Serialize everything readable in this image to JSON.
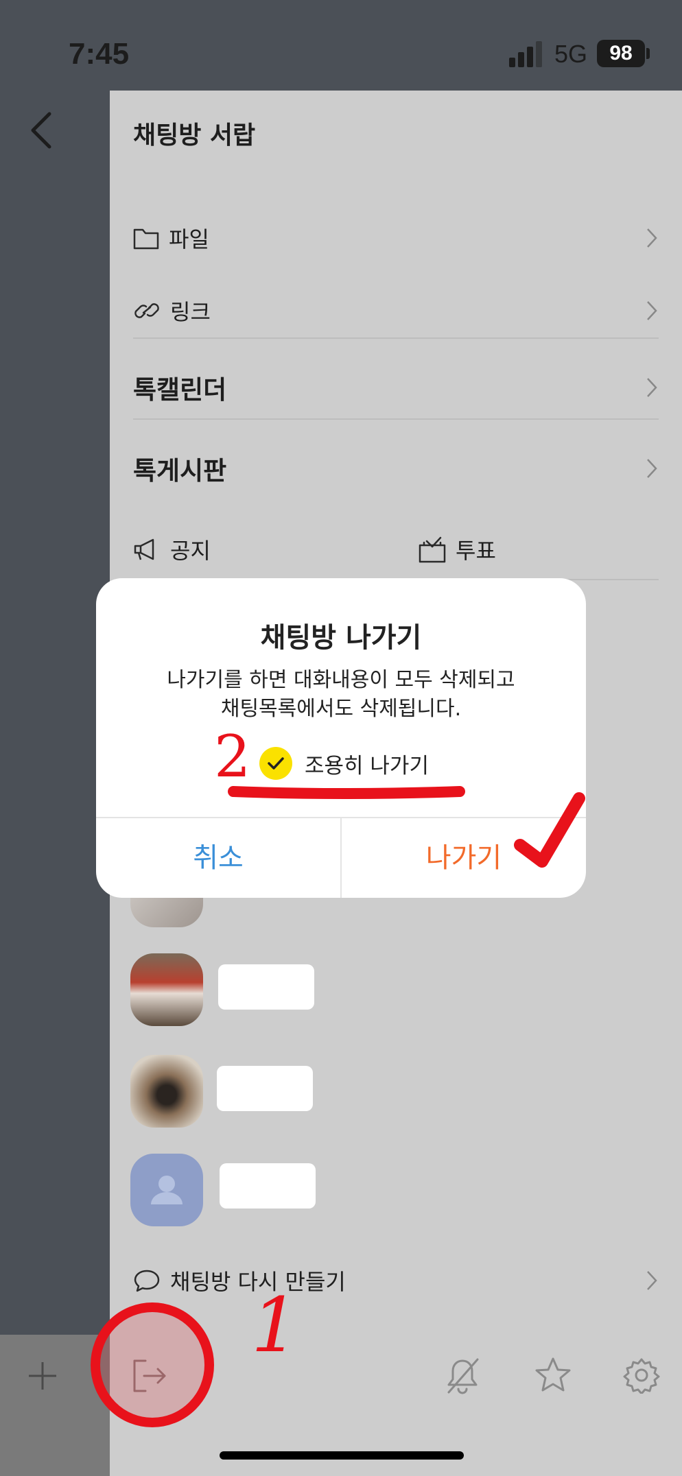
{
  "status_bar": {
    "time": "7:45",
    "network": "5G",
    "battery": "98"
  },
  "drawer": {
    "title": "채팅방 서랍",
    "items": [
      {
        "label": "파일",
        "icon": "folder-icon"
      },
      {
        "label": "링크",
        "icon": "link-icon"
      },
      {
        "label": "톡캘린더"
      },
      {
        "label": "톡게시판"
      }
    ],
    "quick": [
      {
        "label": "공지",
        "icon": "megaphone-icon"
      },
      {
        "label": "투표",
        "icon": "ballot-box-icon"
      }
    ],
    "recreate_label": "채팅방 다시 만들기"
  },
  "dialog": {
    "title": "채팅방 나가기",
    "message_line1": "나가기를 하면 대화내용이 모두 삭제되고",
    "message_line2": "채팅목록에서도 삭제됩니다.",
    "quiet_leave_label": "조용히 나가기",
    "quiet_leave_checked": true,
    "cancel_label": "취소",
    "leave_label": "나가기"
  },
  "annotations": {
    "step1": "1",
    "step2": "2"
  },
  "colors": {
    "accent_yellow": "#fae100",
    "cancel_blue": "#3a8fd8",
    "leave_orange": "#f26a2a",
    "annotation_red": "#e8121b"
  }
}
